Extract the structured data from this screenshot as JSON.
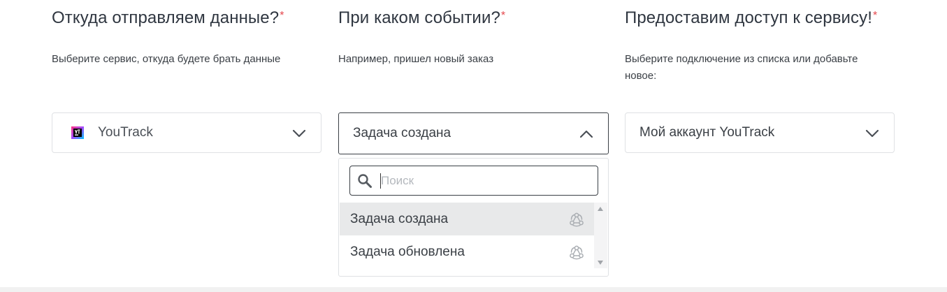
{
  "source": {
    "title": "Откуда отправляем данные?",
    "required_mark": "*",
    "description": "Выберите сервис, откуда будете брать данные",
    "selected_service": "YouTrack",
    "logo_icon": "youtrack-logo-icon",
    "arrow_icon": "chevron-down-icon"
  },
  "event": {
    "title": "При каком событии?",
    "required_mark": "*",
    "description": "Например, пришел новый заказ",
    "selected_event": "Задача создана",
    "arrow_icon": "chevron-up-icon",
    "dropdown": {
      "search_placeholder": "Поиск",
      "search_value": "",
      "search_icon": "search-icon",
      "options": [
        {
          "label": "Задача создана",
          "icon": "webhook-icon",
          "selected": true
        },
        {
          "label": "Задача обновлена",
          "icon": "webhook-icon",
          "selected": false
        }
      ]
    }
  },
  "access": {
    "title": "Предоставим доступ к сервису!",
    "required_mark": "*",
    "description": "Выберите подключение из списка или добавьте новое:",
    "selected_account": "Мой аккаунт YouTrack",
    "arrow_icon": "chevron-down-icon"
  },
  "colors": {
    "text": "#2f3640",
    "required": "#e5484d",
    "border": "#dfe1e4",
    "active_border": "#3a3f45",
    "selected_option_bg": "#e8e9ea"
  }
}
